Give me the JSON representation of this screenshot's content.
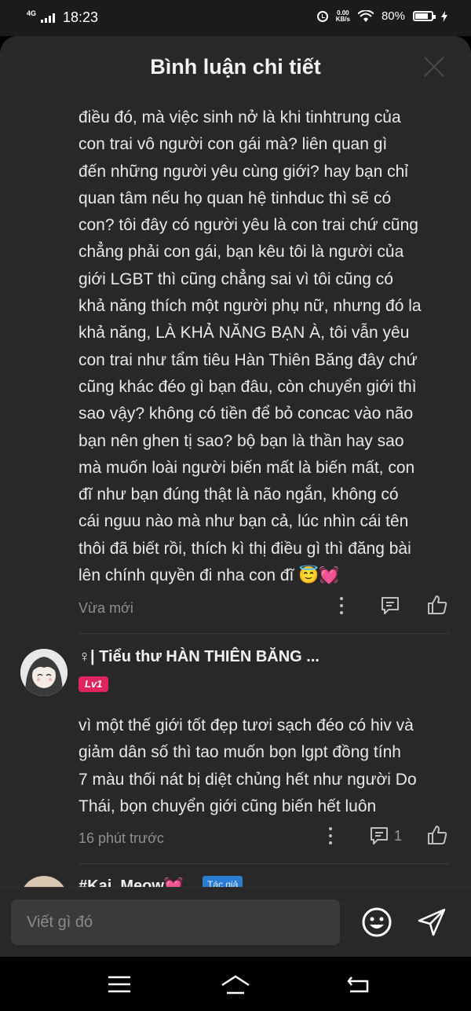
{
  "status_bar": {
    "network": "4G",
    "time": "18:23",
    "data_speed_value": "0.00",
    "data_speed_unit": "KB/s",
    "battery": "80%"
  },
  "sheet": {
    "title": "Bình luận chi tiết"
  },
  "comments": [
    {
      "body_lines": [
        "điều đó, mà việc sinh nở là khi tinhtrung của",
        "con trai vô người con gái mà? liên quan gì",
        "đến những người yêu cùng giới? hay bạn chỉ",
        "quan tâm nếu họ quan hệ tinhduc thì sẽ có",
        "con? tôi đây có người yêu là con trai chứ cũng",
        "chẳng phải con gái, bạn kêu tôi là người của",
        "giới LGBT thì cũng chẳng sai vì tôi cũng có",
        "khả năng thích một người phụ nữ, nhưng đó la",
        "khả năng, LÀ KHẢ NĂNG BẠN À, tôi vẫn yêu",
        "con trai như tẩm tiêu Hàn Thiên Băng đây chứ",
        "cũng khác đéo gì bạn đâu, còn chuyển giới thì",
        "sao vậy? không có tiền để bỏ concac vào não",
        "bạn nên ghen tị sao? bộ bạn là thần hay sao",
        "mà muốn loài người biến mất là biến mất, con",
        "đĩ như bạn đúng thật là não ngắn, không có",
        "cái nguu nào mà như bạn cả, lúc nhìn cái tên",
        "thôi đã biết rồi, thích kì thị điều gì thì đăng bài",
        "lên chính quyền đi nha con đĩ 😇💓"
      ],
      "time": "Vừa mới"
    },
    {
      "username": "♀| Tiểu thư HÀN THIÊN BĂNG ...",
      "level": "Lv1",
      "body_lines": [
        "vì một thế giới tốt đẹp tươi sạch đéo có hiv và",
        "giảm dân số thì tao muốn bọn lgpt đồng tính",
        "7 màu thối nát bị diệt chủng hết như người Do",
        "Thái, bọn chuyển giới cũng biến hết luôn"
      ],
      "time": "16 phút trước",
      "reply_count": "1"
    },
    {
      "username": "#Kai_Meow💓",
      "badge": "Tác giả"
    }
  ],
  "input": {
    "placeholder": "Viết gì đó"
  },
  "icons": {
    "close": "close-icon",
    "more": "more-vertical-icon",
    "reply": "comment-icon",
    "like": "thumbs-up-icon",
    "emoji": "emoji-icon",
    "send": "send-icon",
    "nav_menu": "menu-icon",
    "nav_home": "home-icon",
    "nav_back": "back-icon"
  },
  "colors": {
    "background": "#282828",
    "level_badge": "#e0245e",
    "author_badge": "#2b7cd3"
  }
}
